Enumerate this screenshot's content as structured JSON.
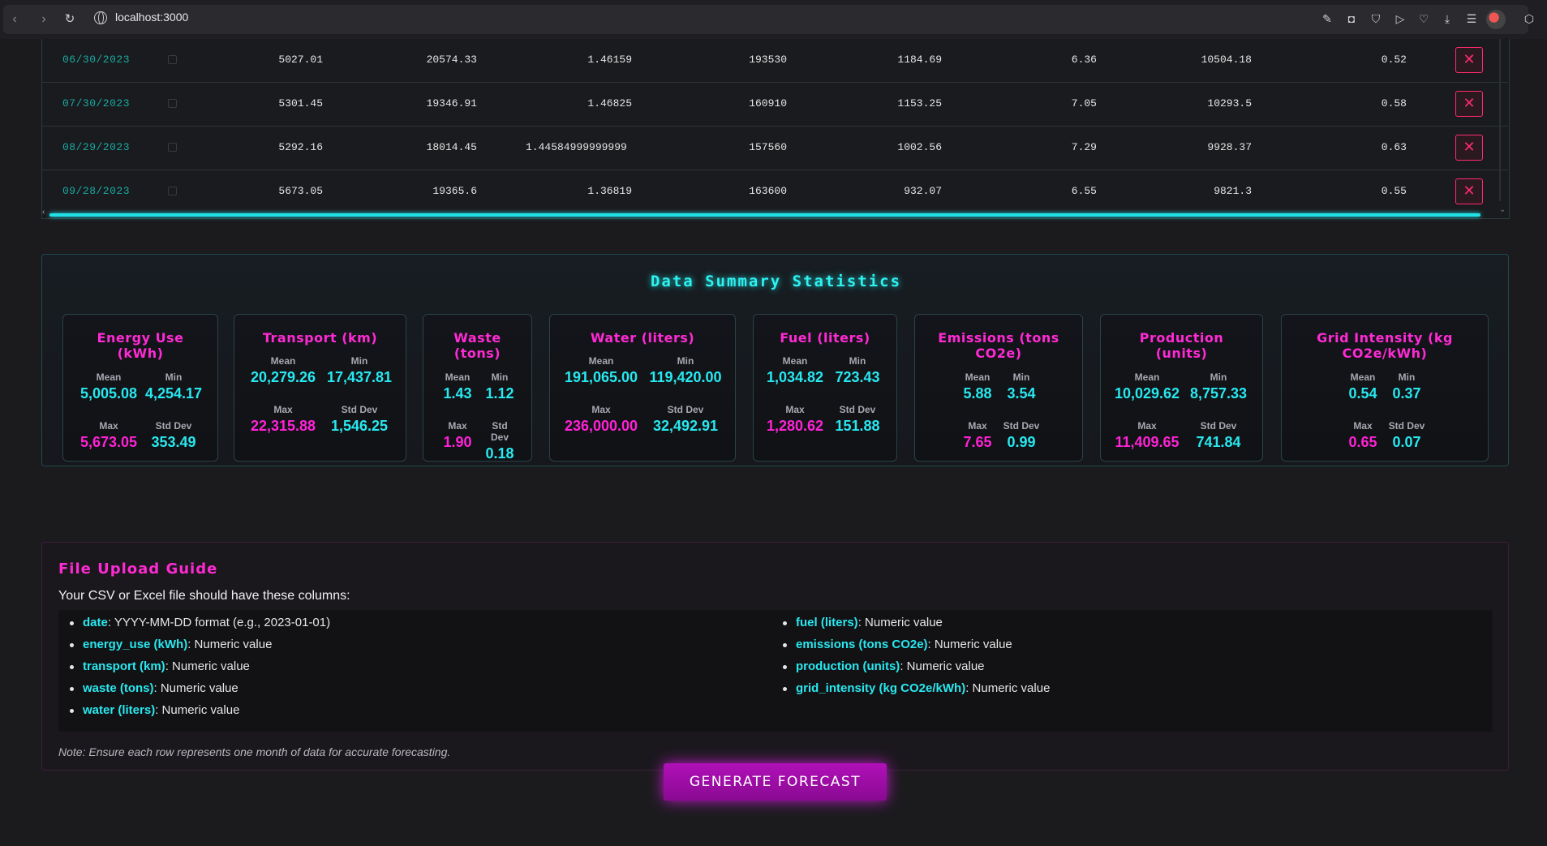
{
  "browser": {
    "url": "localhost:3000"
  },
  "table": {
    "rows": [
      {
        "date": "06/30/2023",
        "energy": "5027.01",
        "transport": "20574.33",
        "waste": "1.46159",
        "water": "193530",
        "fuel": "1184.69",
        "emissions": "6.36",
        "production": "10504.18",
        "grid": "0.52"
      },
      {
        "date": "07/30/2023",
        "energy": "5301.45",
        "transport": "19346.91",
        "waste": "1.46825",
        "water": "160910",
        "fuel": "1153.25",
        "emissions": "7.05",
        "production": "10293.5",
        "grid": "0.58"
      },
      {
        "date": "08/29/2023",
        "energy": "5292.16",
        "transport": "18014.45",
        "waste": "1.44584999999999",
        "water": "157560",
        "fuel": "1002.56",
        "emissions": "7.29",
        "production": "9928.37",
        "grid": "0.63"
      },
      {
        "date": "09/28/2023",
        "energy": "5673.05",
        "transport": "19365.6",
        "waste": "1.36819",
        "water": "163600",
        "fuel": "932.07",
        "emissions": "6.55",
        "production": "9821.3",
        "grid": "0.55"
      }
    ],
    "delete_icon": "close-icon"
  },
  "summary": {
    "title": "Data Summary Statistics",
    "labels": {
      "mean": "Mean",
      "min": "Min",
      "max": "Max",
      "std": "Std Dev",
      "std_a": "Std",
      "std_b": "Dev"
    },
    "cards": [
      {
        "title_1": "Energy Use",
        "title_2": "(kWh)",
        "mean": "5,005.08",
        "min": "4,254.17",
        "max": "5,673.05",
        "std": "353.49"
      },
      {
        "title_1": "Transport (km)",
        "mean": "20,279.26",
        "min": "17,437.81",
        "max": "22,315.88",
        "std": "1,546.25"
      },
      {
        "title_1": "Waste",
        "title_2": "(tons)",
        "mean": "1.43",
        "min": "1.12",
        "max": "1.90",
        "std": "0.18"
      },
      {
        "title_1": "Water (liters)",
        "mean": "191,065.00",
        "min": "119,420.00",
        "max": "236,000.00",
        "std": "32,492.91"
      },
      {
        "title_1": "Fuel (liters)",
        "mean": "1,034.82",
        "min": "723.43",
        "max": "1,280.62",
        "std": "151.88"
      },
      {
        "title_1": "Emissions (tons",
        "title_2": "CO2e)",
        "mean": "5.88",
        "min": "3.54",
        "max": "7.65",
        "std": "0.99"
      },
      {
        "title_1": "Production",
        "title_2": "(units)",
        "mean": "10,029.62",
        "min": "8,757.33",
        "max": "11,409.65",
        "std": "741.84"
      },
      {
        "title_1": "Grid Intensity (kg",
        "title_2": "CO2e/kWh)",
        "mean": "0.54",
        "min": "0.37",
        "max": "0.65",
        "std": "0.07"
      }
    ]
  },
  "guide": {
    "title": "File Upload Guide",
    "intro": "Your CSV or Excel file should have these columns:",
    "left": [
      {
        "key": "date",
        "desc": ": YYYY-MM-DD format (e.g., 2023-01-01)"
      },
      {
        "key": "energy_use (kWh)",
        "desc": ": Numeric value"
      },
      {
        "key": "transport (km)",
        "desc": ": Numeric value"
      },
      {
        "key": "waste (tons)",
        "desc": ": Numeric value"
      },
      {
        "key": "water (liters)",
        "desc": ": Numeric value"
      }
    ],
    "right": [
      {
        "key": "fuel (liters)",
        "desc": ": Numeric value"
      },
      {
        "key": "emissions (tons CO2e)",
        "desc": ": Numeric value"
      },
      {
        "key": "production (units)",
        "desc": ": Numeric value"
      },
      {
        "key": "grid_intensity (kg CO2e/kWh)",
        "desc": ": Numeric value"
      }
    ],
    "note": "Note: Ensure each row represents one month of data for accurate forecasting."
  },
  "action": {
    "generate_label": "GENERATE FORECAST"
  },
  "colors": {
    "accent_cyan": "#28e8f0",
    "accent_magenta": "#ff22d6",
    "delete_red": "#ff2a6d"
  }
}
